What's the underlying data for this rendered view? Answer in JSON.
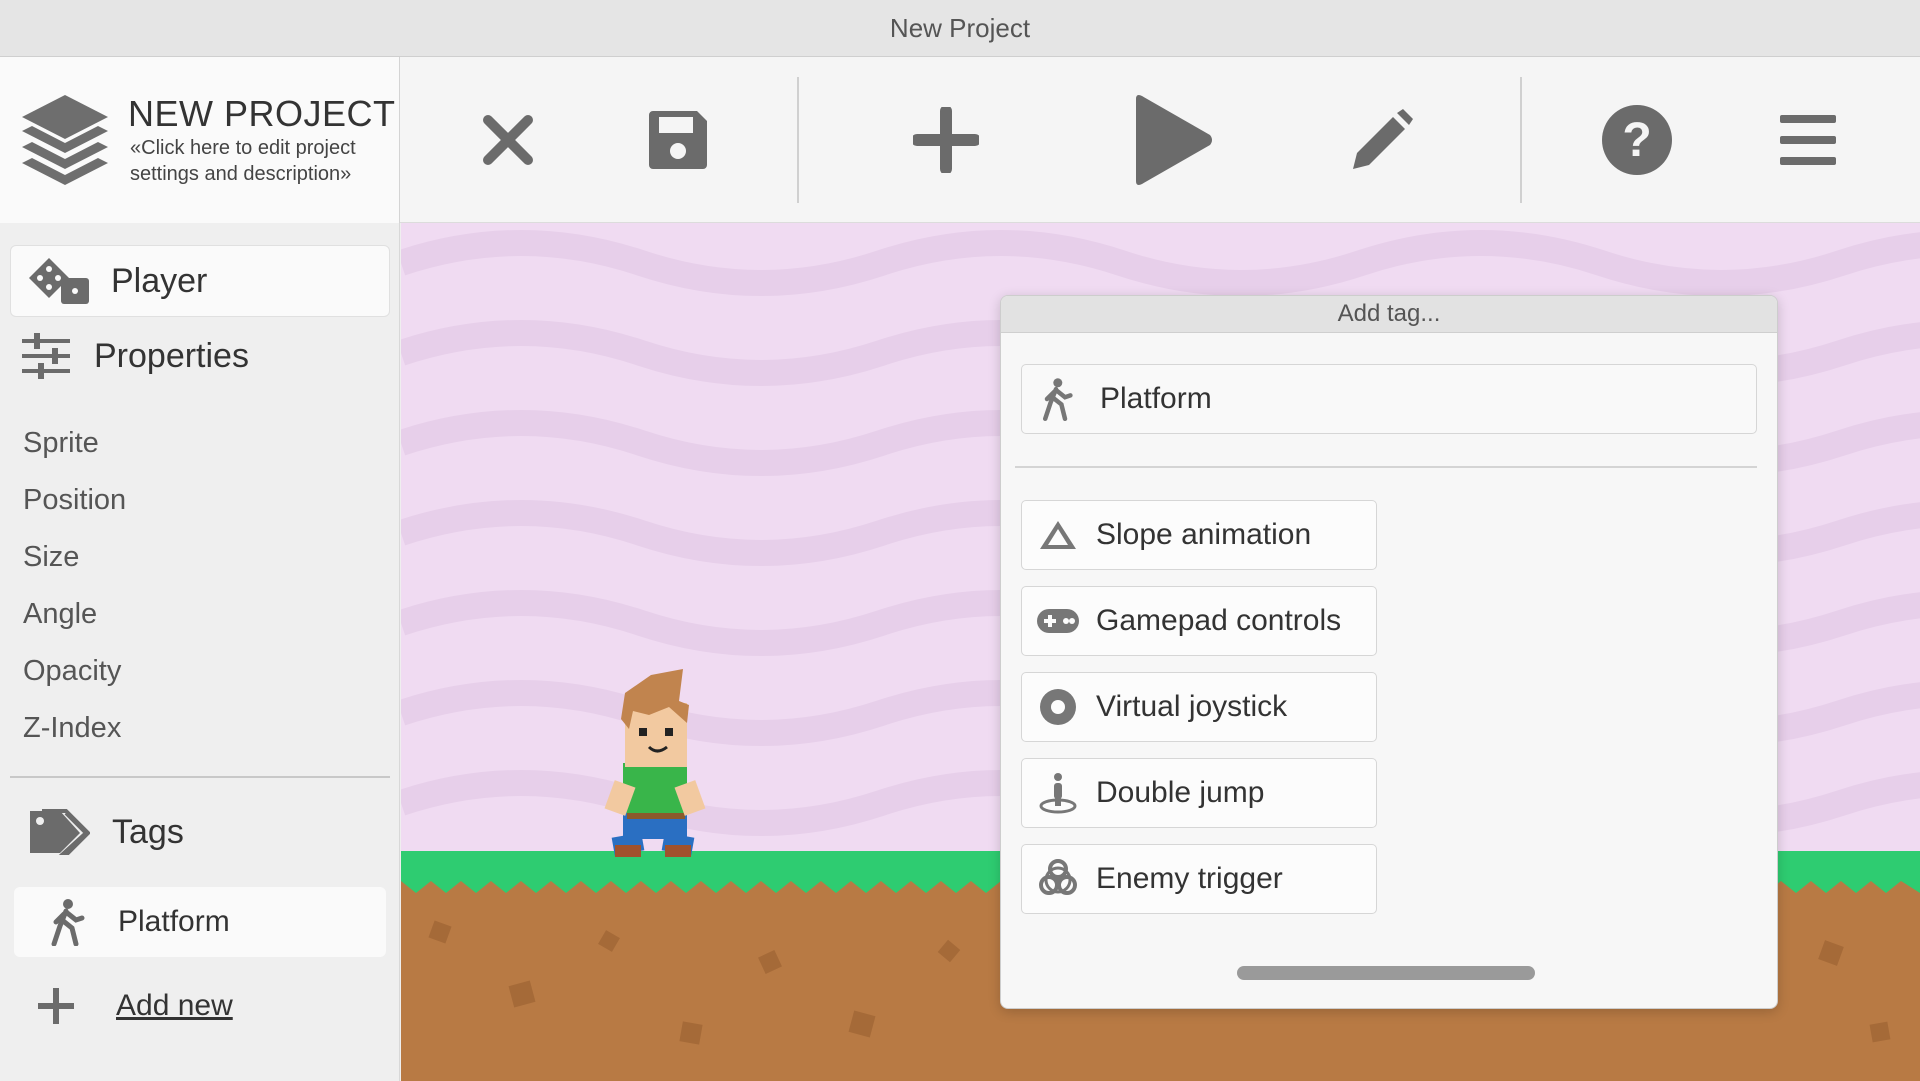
{
  "window": {
    "title": "New Project"
  },
  "project": {
    "name": "NEW PROJECT",
    "description": "«Click here to edit project settings and description»"
  },
  "toolbar": {
    "buttons": [
      {
        "icon": "close-icon"
      },
      {
        "icon": "save-icon"
      },
      {
        "icon": "plus-icon"
      },
      {
        "icon": "play-icon"
      },
      {
        "icon": "pencil-icon"
      },
      {
        "icon": "help-icon"
      },
      {
        "icon": "menu-icon"
      }
    ]
  },
  "sidebar": {
    "object_name": "Player",
    "properties_heading": "Properties",
    "properties": [
      "Sprite",
      "Position",
      "Size",
      "Angle",
      "Opacity",
      "Z-Index"
    ],
    "tags_heading": "Tags",
    "tags": [
      {
        "label": "Platform",
        "icon": "walking-person-icon"
      }
    ],
    "add_new_label": "Add new"
  },
  "dialog": {
    "title": "Add tag...",
    "current": {
      "label": "Platform",
      "icon": "walking-person-icon"
    },
    "options": [
      {
        "label": "Slope animation",
        "icon": "mountain-icon"
      },
      {
        "label": "Gamepad controls",
        "icon": "gamepad-icon"
      },
      {
        "label": "Virtual joystick",
        "icon": "joystick-icon"
      },
      {
        "label": "Double jump",
        "icon": "jumping-person-icon"
      },
      {
        "label": "Enemy trigger",
        "icon": "biohazard-icon"
      }
    ]
  },
  "colors": {
    "canvas_background": "#f0dbf2",
    "grass": "#2ecc71",
    "dirt": "#b87a44",
    "icon_gray": "#777777"
  }
}
